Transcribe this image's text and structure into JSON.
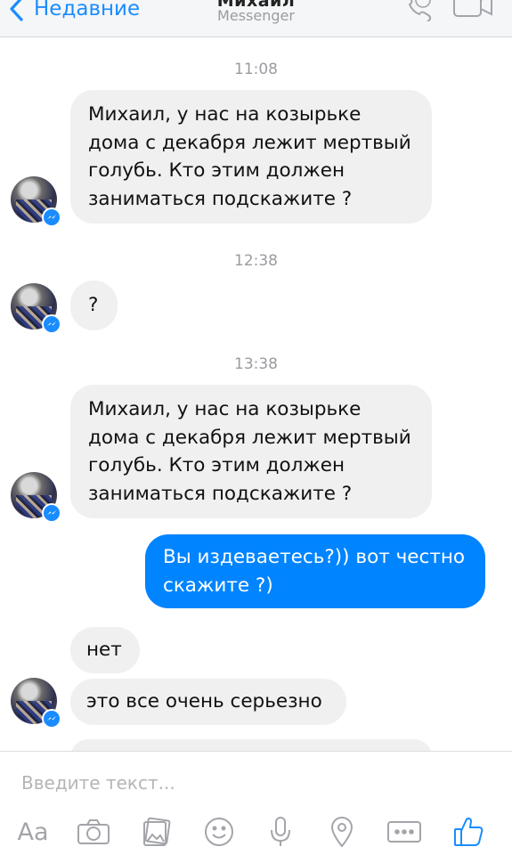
{
  "header": {
    "back_label": "Недавние",
    "title": "Михаил",
    "subtitle": "Messenger"
  },
  "messages": [
    {
      "type": "time",
      "text": "11:08"
    },
    {
      "type": "incoming",
      "lines": [
        "Михаил, у нас на козырьке",
        "дома с декабря лежит мертвый",
        "голубь. Кто этим должен",
        "заниматься подскажите ?"
      ]
    },
    {
      "type": "time",
      "text": "12:38"
    },
    {
      "type": "incoming",
      "lines": [
        "?"
      ]
    },
    {
      "type": "time",
      "text": "13:38"
    },
    {
      "type": "incoming",
      "lines": [
        "Михаил, у нас на козырьке",
        "дома с декабря лежит мертвый",
        "голубь. Кто этим должен",
        "заниматься подскажите ?"
      ]
    },
    {
      "type": "outgoing",
      "lines": [
        "Вы издеваетесь?)) вот честно",
        "скажите ?)"
      ]
    },
    {
      "type": "incoming",
      "lines": [
        "нет"
      ]
    },
    {
      "type": "incoming",
      "lines": [
        "это все очень серьезно"
      ]
    }
  ],
  "composer": {
    "placeholder": "Введите текст...",
    "aa_label": "Aa",
    "tools": [
      "text-format-icon",
      "camera-icon",
      "gallery-icon",
      "emoji-icon",
      "microphone-icon",
      "location-icon",
      "more-icon",
      "like-icon"
    ]
  },
  "colors": {
    "accent": "#1a8cff",
    "outgoing_bubble": "#0084ff",
    "incoming_bubble": "#f1f0f0"
  }
}
